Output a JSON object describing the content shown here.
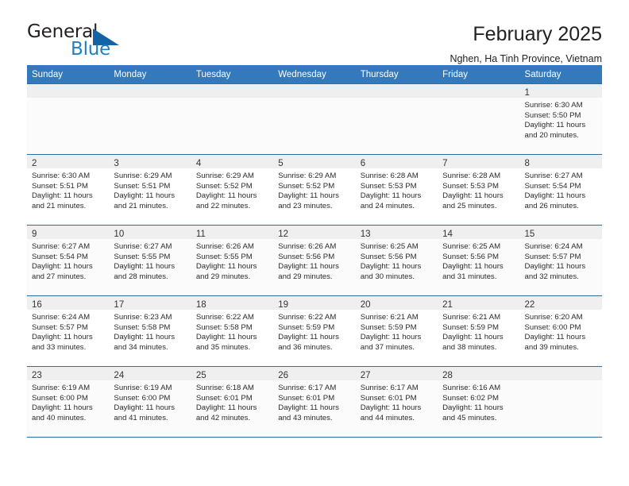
{
  "brand": {
    "name_top": "General",
    "name_bottom": "Blue",
    "triangle_color": "#1464a5"
  },
  "header": {
    "title": "February 2025",
    "subtitle": "Nghen, Ha Tinh Province, Vietnam",
    "accent_color": "#3479bb"
  },
  "weekdays": [
    "Sunday",
    "Monday",
    "Tuesday",
    "Wednesday",
    "Thursday",
    "Friday",
    "Saturday"
  ],
  "weeks": [
    [
      {
        "day": "",
        "lines": []
      },
      {
        "day": "",
        "lines": []
      },
      {
        "day": "",
        "lines": []
      },
      {
        "day": "",
        "lines": []
      },
      {
        "day": "",
        "lines": []
      },
      {
        "day": "",
        "lines": []
      },
      {
        "day": "1",
        "lines": [
          "Sunrise: 6:30 AM",
          "Sunset: 5:50 PM",
          "Daylight: 11 hours",
          "and 20 minutes."
        ]
      }
    ],
    [
      {
        "day": "2",
        "lines": [
          "Sunrise: 6:30 AM",
          "Sunset: 5:51 PM",
          "Daylight: 11 hours",
          "and 21 minutes."
        ]
      },
      {
        "day": "3",
        "lines": [
          "Sunrise: 6:29 AM",
          "Sunset: 5:51 PM",
          "Daylight: 11 hours",
          "and 21 minutes."
        ]
      },
      {
        "day": "4",
        "lines": [
          "Sunrise: 6:29 AM",
          "Sunset: 5:52 PM",
          "Daylight: 11 hours",
          "and 22 minutes."
        ]
      },
      {
        "day": "5",
        "lines": [
          "Sunrise: 6:29 AM",
          "Sunset: 5:52 PM",
          "Daylight: 11 hours",
          "and 23 minutes."
        ]
      },
      {
        "day": "6",
        "lines": [
          "Sunrise: 6:28 AM",
          "Sunset: 5:53 PM",
          "Daylight: 11 hours",
          "and 24 minutes."
        ]
      },
      {
        "day": "7",
        "lines": [
          "Sunrise: 6:28 AM",
          "Sunset: 5:53 PM",
          "Daylight: 11 hours",
          "and 25 minutes."
        ]
      },
      {
        "day": "8",
        "lines": [
          "Sunrise: 6:27 AM",
          "Sunset: 5:54 PM",
          "Daylight: 11 hours",
          "and 26 minutes."
        ]
      }
    ],
    [
      {
        "day": "9",
        "lines": [
          "Sunrise: 6:27 AM",
          "Sunset: 5:54 PM",
          "Daylight: 11 hours",
          "and 27 minutes."
        ]
      },
      {
        "day": "10",
        "lines": [
          "Sunrise: 6:27 AM",
          "Sunset: 5:55 PM",
          "Daylight: 11 hours",
          "and 28 minutes."
        ]
      },
      {
        "day": "11",
        "lines": [
          "Sunrise: 6:26 AM",
          "Sunset: 5:55 PM",
          "Daylight: 11 hours",
          "and 29 minutes."
        ]
      },
      {
        "day": "12",
        "lines": [
          "Sunrise: 6:26 AM",
          "Sunset: 5:56 PM",
          "Daylight: 11 hours",
          "and 29 minutes."
        ]
      },
      {
        "day": "13",
        "lines": [
          "Sunrise: 6:25 AM",
          "Sunset: 5:56 PM",
          "Daylight: 11 hours",
          "and 30 minutes."
        ]
      },
      {
        "day": "14",
        "lines": [
          "Sunrise: 6:25 AM",
          "Sunset: 5:56 PM",
          "Daylight: 11 hours",
          "and 31 minutes."
        ]
      },
      {
        "day": "15",
        "lines": [
          "Sunrise: 6:24 AM",
          "Sunset: 5:57 PM",
          "Daylight: 11 hours",
          "and 32 minutes."
        ]
      }
    ],
    [
      {
        "day": "16",
        "lines": [
          "Sunrise: 6:24 AM",
          "Sunset: 5:57 PM",
          "Daylight: 11 hours",
          "and 33 minutes."
        ]
      },
      {
        "day": "17",
        "lines": [
          "Sunrise: 6:23 AM",
          "Sunset: 5:58 PM",
          "Daylight: 11 hours",
          "and 34 minutes."
        ]
      },
      {
        "day": "18",
        "lines": [
          "Sunrise: 6:22 AM",
          "Sunset: 5:58 PM",
          "Daylight: 11 hours",
          "and 35 minutes."
        ]
      },
      {
        "day": "19",
        "lines": [
          "Sunrise: 6:22 AM",
          "Sunset: 5:59 PM",
          "Daylight: 11 hours",
          "and 36 minutes."
        ]
      },
      {
        "day": "20",
        "lines": [
          "Sunrise: 6:21 AM",
          "Sunset: 5:59 PM",
          "Daylight: 11 hours",
          "and 37 minutes."
        ]
      },
      {
        "day": "21",
        "lines": [
          "Sunrise: 6:21 AM",
          "Sunset: 5:59 PM",
          "Daylight: 11 hours",
          "and 38 minutes."
        ]
      },
      {
        "day": "22",
        "lines": [
          "Sunrise: 6:20 AM",
          "Sunset: 6:00 PM",
          "Daylight: 11 hours",
          "and 39 minutes."
        ]
      }
    ],
    [
      {
        "day": "23",
        "lines": [
          "Sunrise: 6:19 AM",
          "Sunset: 6:00 PM",
          "Daylight: 11 hours",
          "and 40 minutes."
        ]
      },
      {
        "day": "24",
        "lines": [
          "Sunrise: 6:19 AM",
          "Sunset: 6:00 PM",
          "Daylight: 11 hours",
          "and 41 minutes."
        ]
      },
      {
        "day": "25",
        "lines": [
          "Sunrise: 6:18 AM",
          "Sunset: 6:01 PM",
          "Daylight: 11 hours",
          "and 42 minutes."
        ]
      },
      {
        "day": "26",
        "lines": [
          "Sunrise: 6:17 AM",
          "Sunset: 6:01 PM",
          "Daylight: 11 hours",
          "and 43 minutes."
        ]
      },
      {
        "day": "27",
        "lines": [
          "Sunrise: 6:17 AM",
          "Sunset: 6:01 PM",
          "Daylight: 11 hours",
          "and 44 minutes."
        ]
      },
      {
        "day": "28",
        "lines": [
          "Sunrise: 6:16 AM",
          "Sunset: 6:02 PM",
          "Daylight: 11 hours",
          "and 45 minutes."
        ]
      },
      {
        "day": "",
        "lines": []
      }
    ]
  ]
}
